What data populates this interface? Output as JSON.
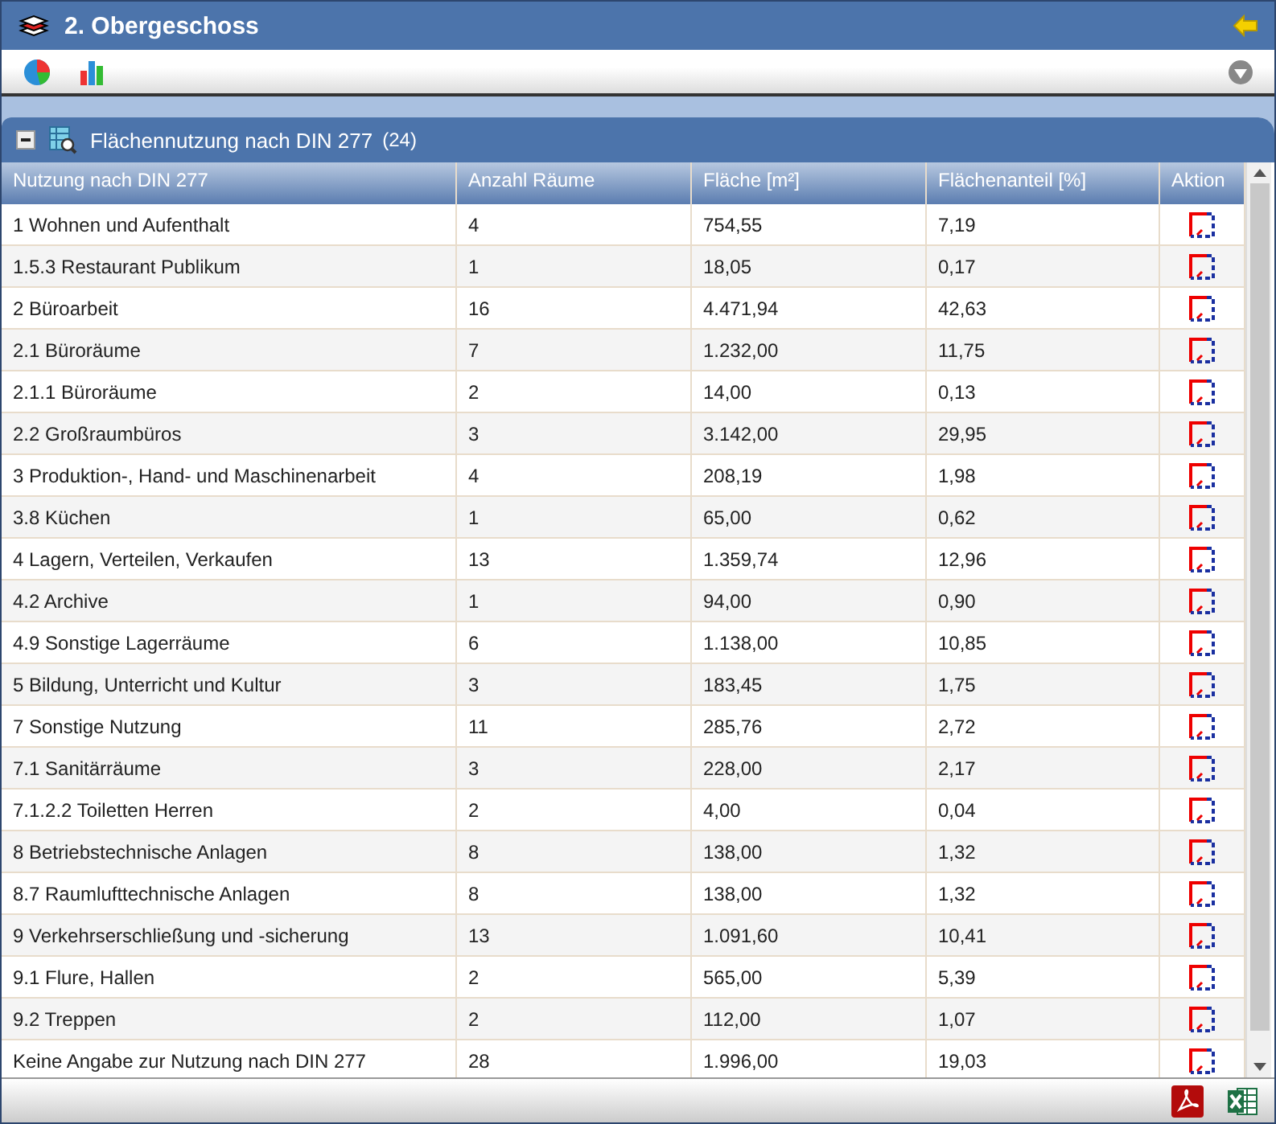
{
  "window": {
    "title": "2. Obergeschoss"
  },
  "panel": {
    "title": "Flächennutzung nach DIN 277",
    "count": "(24)",
    "expanded": true
  },
  "table": {
    "columns": [
      "Nutzung nach DIN 277",
      "Anzahl Räume",
      "Fläche [m²]",
      "Flächenanteil [%]",
      "Aktion"
    ],
    "rows": [
      [
        "1 Wohnen und Aufenthalt",
        "4",
        "754,55",
        "7,19"
      ],
      [
        "1.5.3 Restaurant Publikum",
        "1",
        "18,05",
        "0,17"
      ],
      [
        "2 Büroarbeit",
        "16",
        "4.471,94",
        "42,63"
      ],
      [
        "2.1 Büroräume",
        "7",
        "1.232,00",
        "11,75"
      ],
      [
        "2.1.1 Büroräume",
        "2",
        "14,00",
        "0,13"
      ],
      [
        "2.2 Großraumbüros",
        "3",
        "3.142,00",
        "29,95"
      ],
      [
        "3 Produktion-, Hand- und Maschinenarbeit",
        "4",
        "208,19",
        "1,98"
      ],
      [
        "3.8 Küchen",
        "1",
        "65,00",
        "0,62"
      ],
      [
        "4 Lagern, Verteilen, Verkaufen",
        "13",
        "1.359,74",
        "12,96"
      ],
      [
        "4.2 Archive",
        "1",
        "94,00",
        "0,90"
      ],
      [
        "4.9 Sonstige Lagerräume",
        "6",
        "1.138,00",
        "10,85"
      ],
      [
        "5 Bildung, Unterricht und Kultur",
        "3",
        "183,45",
        "1,75"
      ],
      [
        "7 Sonstige Nutzung",
        "11",
        "285,76",
        "2,72"
      ],
      [
        "7.1 Sanitärräume",
        "3",
        "228,00",
        "2,17"
      ],
      [
        "7.1.2.2 Toiletten Herren",
        "2",
        "4,00",
        "0,04"
      ],
      [
        "8 Betriebstechnische Anlagen",
        "8",
        "138,00",
        "1,32"
      ],
      [
        "8.7 Raumlufttechnische Anlagen",
        "8",
        "138,00",
        "1,32"
      ],
      [
        "9 Verkehrserschließung und -sicherung",
        "13",
        "1.091,60",
        "10,41"
      ],
      [
        "9.1 Flure, Hallen",
        "2",
        "565,00",
        "5,39"
      ],
      [
        "9.2 Treppen",
        "2",
        "112,00",
        "1,07"
      ],
      [
        "Keine Angabe zur Nutzung nach DIN 277",
        "28",
        "1.996,00",
        "19,03"
      ]
    ]
  }
}
